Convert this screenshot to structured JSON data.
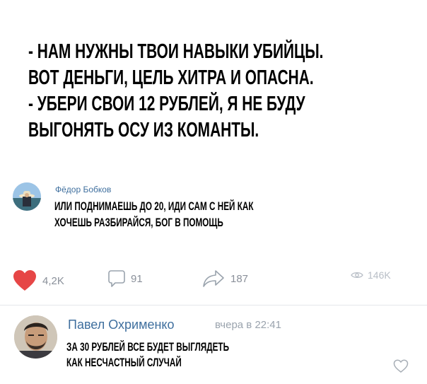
{
  "post": {
    "lines": [
      "- НАМ НУЖНЫ ТВОИ НАВЫКИ  УБИЙЦЫ.",
      "ВОТ ДЕНЬГИ, ЦЕЛЬ ХИТРА И ОПАСНА.",
      "- УБЕРИ СВОИ 12 РУБЛЕЙ, Я НЕ БУДУ",
      "ВЫГОНЯТЬ ОСУ ИЗ КОМАНТЫ."
    ]
  },
  "comment1": {
    "author": "Фёдор Бобков",
    "lines": [
      "ИЛИ ПОДНИМАЕШЬ ДО 20, ИДИ САМ С НЕЙ КАК",
      "ХОЧЕШЬ РАЗБИРАЙСЯ, БОГ В ПОМОЩЬ"
    ]
  },
  "actions": {
    "likes": "4,2K",
    "comments": "91",
    "shares": "187",
    "views": "146K",
    "like_color": "#e64646"
  },
  "comment2": {
    "author": "Павел Охрименко",
    "time": "вчера в 22:41",
    "lines": [
      "ЗА 30 РУБЛЕЙ ВСЕ БУДЕТ ВЫГЛЯДЕТЬ",
      "КАК НЕСЧАСТНЫЙ СЛУЧАЙ"
    ]
  }
}
